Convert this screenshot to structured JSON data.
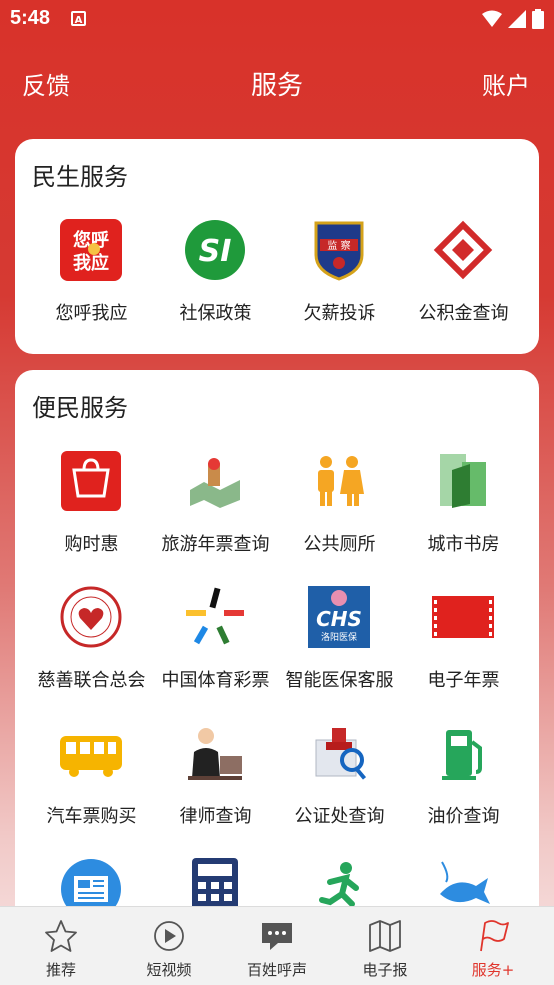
{
  "status_bar": {
    "time": "5:48",
    "app_icon": "A"
  },
  "header": {
    "left": "反馈",
    "title": "服务",
    "right": "账户"
  },
  "section1": {
    "title": "民生服务",
    "items": [
      {
        "label": "您呼我应",
        "icon": "ninhu-icon",
        "icon_text": "您呼\n我应"
      },
      {
        "label": "社保政策",
        "icon": "si-icon",
        "icon_text": "SI"
      },
      {
        "label": "欠薪投诉",
        "icon": "labor-badge-icon",
        "icon_text": "监察"
      },
      {
        "label": "公积金查询",
        "icon": "housing-fund-icon"
      }
    ]
  },
  "section2": {
    "title": "便民服务",
    "items": [
      {
        "label": "购时惠",
        "icon": "shopping-bag-icon"
      },
      {
        "label": "旅游年票查询",
        "icon": "travel-map-icon"
      },
      {
        "label": "公共厕所",
        "icon": "toilet-icon"
      },
      {
        "label": "城市书房",
        "icon": "book-building-icon"
      },
      {
        "label": "慈善联合总会",
        "icon": "charity-emblem-icon"
      },
      {
        "label": "中国体育彩票",
        "icon": "lottery-star-icon"
      },
      {
        "label": "智能医保客服",
        "icon": "medical-insurance-icon",
        "icon_text": "CHS",
        "icon_subtext": "洛阳医保"
      },
      {
        "label": "电子年票",
        "icon": "ticket-icon"
      },
      {
        "label": "汽车票购买",
        "icon": "bus-icon"
      },
      {
        "label": "律师查询",
        "icon": "lawyer-icon"
      },
      {
        "label": "公证处查询",
        "icon": "notary-stamp-icon"
      },
      {
        "label": "油价查询",
        "icon": "fuel-pump-icon"
      },
      {
        "label": "",
        "icon": "newspaper-icon"
      },
      {
        "label": "",
        "icon": "calculator-icon"
      },
      {
        "label": "",
        "icon": "running-icon"
      },
      {
        "label": "",
        "icon": "fishing-icon"
      }
    ]
  },
  "tab_bar": {
    "tabs": [
      {
        "label": "推荐",
        "icon": "star-icon",
        "active": false
      },
      {
        "label": "短视频",
        "icon": "play-icon",
        "active": false
      },
      {
        "label": "百姓呼声",
        "icon": "chat-icon",
        "active": false
      },
      {
        "label": "电子报",
        "icon": "map-book-icon",
        "active": false
      },
      {
        "label": "服务+",
        "icon": "flag-icon",
        "active": true
      }
    ]
  },
  "colors": {
    "primary": "#d8322a",
    "active_tab": "#e0352c"
  }
}
